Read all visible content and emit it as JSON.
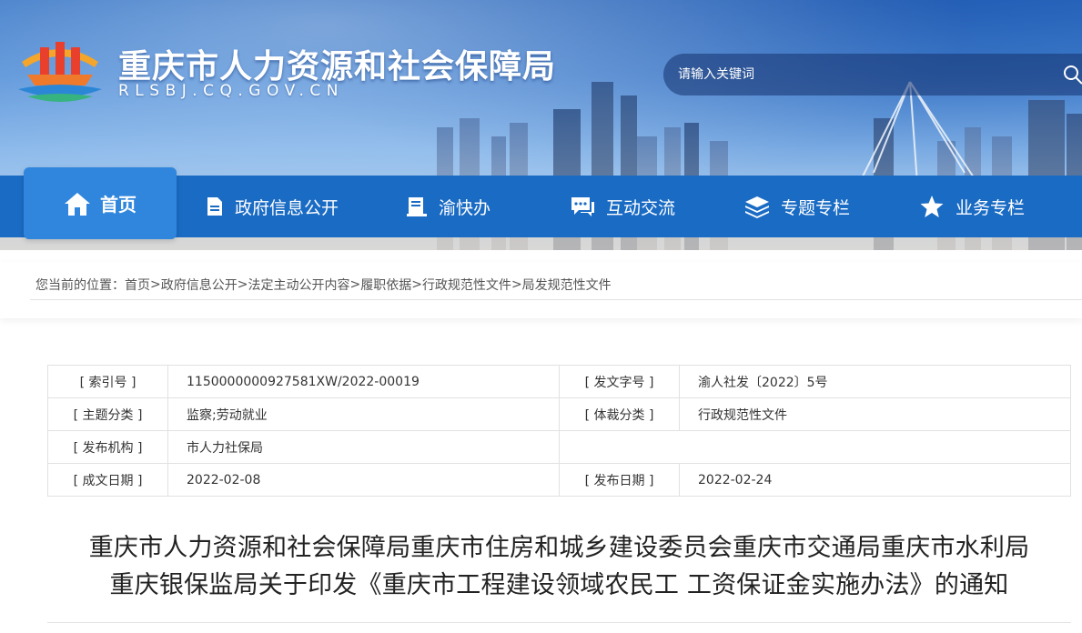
{
  "header": {
    "site_title": "重庆市人力资源和社会保障局",
    "site_domain": "RLSBJ.CQ.GOV.CN",
    "search": {
      "placeholder": "请输入关键词",
      "icon": "search-icon"
    },
    "logo": "chongqing-hrss-logo"
  },
  "nav": {
    "items": [
      {
        "label": "首页",
        "icon": "home-icon",
        "active": true
      },
      {
        "label": "政府信息公开",
        "icon": "document-icon"
      },
      {
        "label": "渝快办",
        "icon": "ledger-icon"
      },
      {
        "label": "互动交流",
        "icon": "chat-icon"
      },
      {
        "label": "专题专栏",
        "icon": "layers-icon"
      },
      {
        "label": "业务专栏",
        "icon": "star-icon"
      }
    ],
    "colors": {
      "bar": "#1a6bc4",
      "active": "#2f86dc"
    }
  },
  "breadcrumb": {
    "prefix": "您当前的位置：",
    "items": [
      "首页",
      "政府信息公开",
      "法定主动公开内容",
      "履职依据",
      "行政规范性文件",
      "局发规范性文件"
    ],
    "separator": ">"
  },
  "meta": {
    "index_key": "[ 索引号 ]",
    "index_value": "11500000009275​81XW/2022-00019",
    "doc_no_key": "[ 发文字号 ]",
    "doc_no_value": "渝人社发〔2022〕5号",
    "topic_key": "[ 主题分类 ]",
    "topic_value": "监察;劳动就业",
    "genre_key": "[ 体裁分类 ]",
    "genre_value": "行政规范性文件",
    "issuer_key": "[ 发布机构 ]",
    "issuer_value": "市人力社保局",
    "date_key": "[ 成文日期 ]",
    "date_value": "2022-02-08",
    "publish_key": "[ 发布日期 ]",
    "publish_value": "2022-02-24"
  },
  "document": {
    "title_line1": "重庆市人力资源和社会保障局重庆市住房和城乡建设委员会重庆市交通局重庆市水利局",
    "title_line2": "重庆银保监局关于印发《重庆市工程建设领域农民工 工资保证金实施办法》的通知"
  }
}
